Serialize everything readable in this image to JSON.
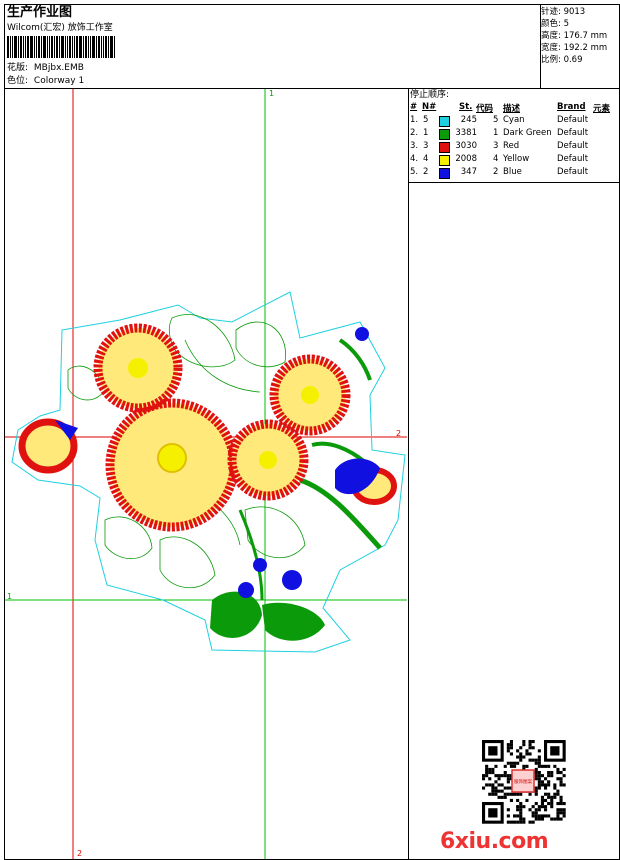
{
  "header": {
    "title": "生产作业图",
    "subtitle": "Wilcom(汇宏) 放饰工作室",
    "pattern_label": "花版:",
    "pattern_value": "MBjbx.EMB",
    "color_label": "色位:",
    "color_value": "Colorway 1"
  },
  "meta": {
    "stitches": "针迹: 9013",
    "colors": "颜色: 5",
    "height": "高度: 176.7 mm",
    "width": "宽度: 192.2 mm",
    "scale": "比例: 0.69"
  },
  "stop_sequence": {
    "title": "停止顺序:",
    "columns": [
      "#",
      "N#",
      "St.",
      "代码",
      "描述",
      "Brand",
      "元素"
    ],
    "rows": [
      {
        "idx": "1.",
        "n": "5",
        "color": "#1fd1e0",
        "st": "245",
        "code": "5",
        "desc": "Cyan",
        "brand": "Default"
      },
      {
        "idx": "2.",
        "n": "1",
        "color": "#0a9a0a",
        "st": "3381",
        "code": "1",
        "desc": "Dark Green",
        "brand": "Default"
      },
      {
        "idx": "3.",
        "n": "3",
        "color": "#e0120f",
        "st": "3030",
        "code": "3",
        "desc": "Red",
        "brand": "Default"
      },
      {
        "idx": "4.",
        "n": "4",
        "color": "#f5f000",
        "st": "2008",
        "code": "4",
        "desc": "Yellow",
        "brand": "Default"
      },
      {
        "idx": "5.",
        "n": "2",
        "color": "#1010e0",
        "st": "347",
        "code": "2",
        "desc": "Blue",
        "brand": "Default"
      }
    ]
  },
  "guides": {
    "label_top": "1",
    "label_right": "2",
    "label_left": "1",
    "label_bottom": "2",
    "red_color": "#e00000",
    "green_color": "#00c000"
  },
  "watermark": {
    "logo": "6xiu.com",
    "seal": "服饰图案"
  }
}
